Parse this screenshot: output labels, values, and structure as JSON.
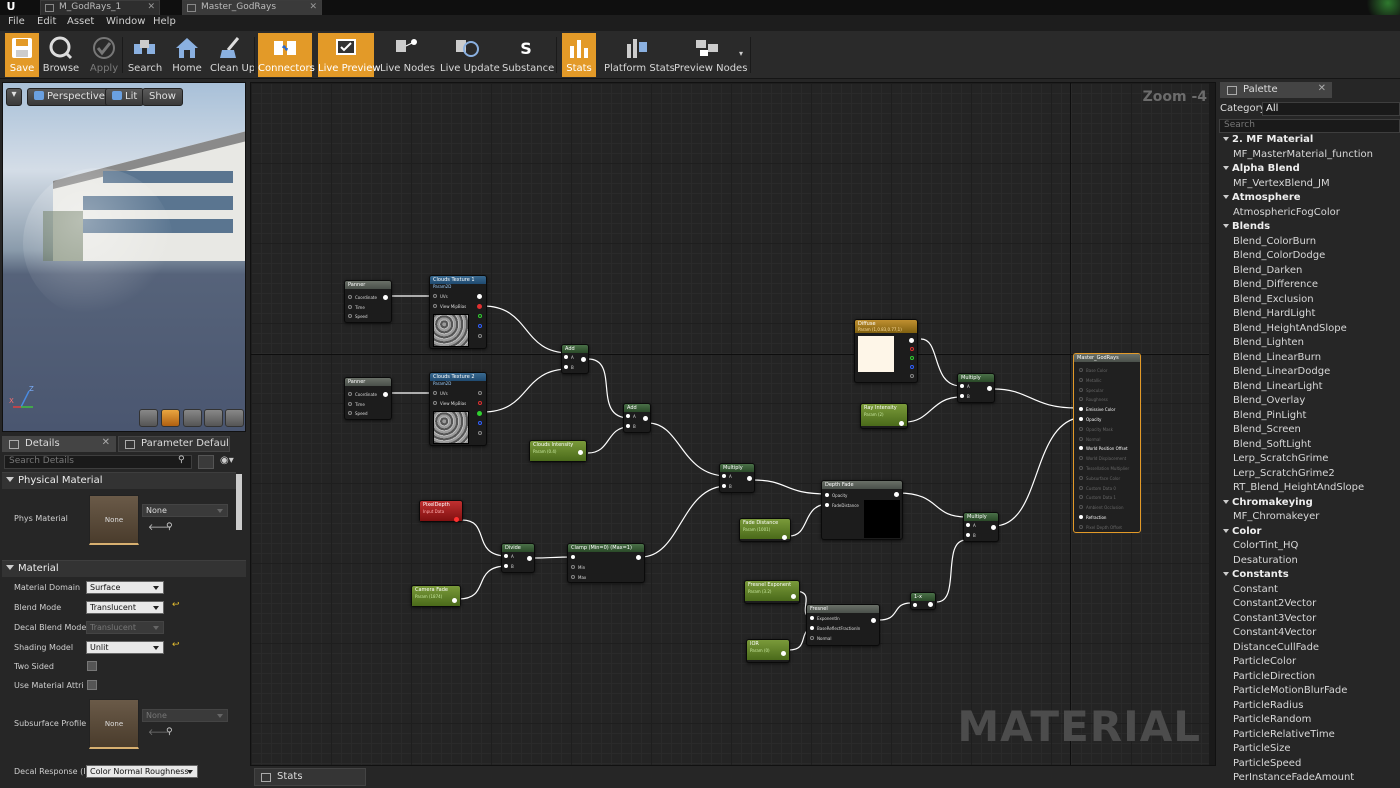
{
  "tabs": [
    {
      "label": "M_GodRays_1"
    },
    {
      "label": "Master_GodRays"
    }
  ],
  "menu": [
    "File",
    "Edit",
    "Asset",
    "Window",
    "Help"
  ],
  "toolbar": [
    {
      "label": "Save",
      "icon": "save-icon",
      "state": "active"
    },
    {
      "label": "Browse",
      "icon": "browse-icon"
    },
    {
      "label": "Apply",
      "icon": "apply-icon",
      "state": "disabled"
    },
    {
      "label": "Search",
      "icon": "search-icon"
    },
    {
      "label": "Home",
      "icon": "home-icon"
    },
    {
      "label": "Clean Up",
      "icon": "clean-up-icon"
    },
    {
      "label": "Connectors",
      "icon": "connectors-icon",
      "state": "active"
    },
    {
      "label": "Live Preview",
      "icon": "live-preview-icon",
      "state": "active"
    },
    {
      "label": "Live Nodes",
      "icon": "live-nodes-icon"
    },
    {
      "label": "Live Update",
      "icon": "live-update-icon"
    },
    {
      "label": "Substance",
      "icon": "substance-icon"
    },
    {
      "label": "Stats",
      "icon": "stats-icon",
      "state": "active"
    },
    {
      "label": "Platform Stats",
      "icon": "platform-stats-icon"
    },
    {
      "label": "Preview Nodes",
      "icon": "preview-nodes-icon"
    }
  ],
  "viewport": {
    "perspective_label": "Perspective",
    "lit_label": "Lit",
    "show_label": "Show",
    "axis_z": "Z",
    "axis_x": "X"
  },
  "details": {
    "tab_label": "Details",
    "param_tab_label": "Parameter Defaults",
    "search_placeholder": "Search Details",
    "physical_material": {
      "header": "Physical Material",
      "phys_material_label": "Phys Material",
      "phys_material_thumb": "None",
      "phys_material_value": "None"
    },
    "material": {
      "header": "Material",
      "material_domain_label": "Material Domain",
      "material_domain_value": "Surface",
      "blend_mode_label": "Blend Mode",
      "blend_mode_value": "Translucent",
      "decal_blend_mode_label": "Decal Blend Mode",
      "decal_blend_mode_value": "Translucent",
      "shading_model_label": "Shading Model",
      "shading_model_value": "Unlit",
      "two_sided_label": "Two Sided",
      "use_material_attri_label": "Use Material Attri",
      "subsurface_profile_label": "Subsurface Profile",
      "subsurface_thumb": "None",
      "subsurface_value": "None",
      "decal_response_label": "Decal Response (I",
      "decal_response_value": "Color Normal Roughness"
    }
  },
  "graph": {
    "zoom": "Zoom -4",
    "watermark": "MATERIAL",
    "nodes": {
      "panner1": {
        "title": "Panner",
        "pins": [
          "Coordinate",
          "Time",
          "Speed"
        ]
      },
      "clouds1": {
        "title": "Clouds Texture 1",
        "sub": "Param2D",
        "pins": [
          "UVs",
          "View MipBias"
        ]
      },
      "panner2": {
        "title": "Panner",
        "pins": [
          "Coordinate",
          "Time",
          "Speed"
        ]
      },
      "clouds2": {
        "title": "Clouds Texture 2",
        "sub": "Param2D",
        "pins": [
          "UVs",
          "View MipBias"
        ]
      },
      "add1": {
        "title": "Add",
        "pins": [
          "A",
          "B"
        ]
      },
      "add2": {
        "title": "Add",
        "pins": [
          "A",
          "B"
        ]
      },
      "clouds_intensity": {
        "title": "Clouds Intensity",
        "sub": "Param (0.4)"
      },
      "multiply1": {
        "title": "Multiply",
        "pins": [
          "A",
          "B"
        ]
      },
      "pixel_depth": {
        "title": "PixelDepth",
        "sub": "Input Data"
      },
      "camera_fade": {
        "title": "Camera Fade",
        "sub": "Param (1874)"
      },
      "divide": {
        "title": "Divide",
        "pins": [
          "A",
          "B"
        ]
      },
      "clamp": {
        "title": "Clamp (Min=0) (Max=1)",
        "pins": [
          "",
          "Min",
          "Max"
        ]
      },
      "depth_fade": {
        "title": "Depth Fade",
        "pins": [
          "Opacity",
          "FadeDistance"
        ]
      },
      "fade_distance": {
        "title": "Fade Distance",
        "sub": "Param (1001)"
      },
      "diffuse": {
        "title": "Diffuse",
        "sub": "Param (1,0.83,0.77,1)"
      },
      "ray_intensity": {
        "title": "Ray Intensity",
        "sub": "Param (2)"
      },
      "multiply2": {
        "title": "Multiply",
        "pins": [
          "A",
          "B"
        ]
      },
      "multiply3": {
        "title": "Multiply",
        "pins": [
          "A",
          "B"
        ]
      },
      "fresnel_exponent": {
        "title": "Fresnel Exponent",
        "sub": "Param (3.2)"
      },
      "ior": {
        "title": "IOR",
        "sub": "Param (0)"
      },
      "fresnel": {
        "title": "Fresnel",
        "pins": [
          "ExponentIn",
          "BaseReflectFractionIn",
          "Normal"
        ]
      },
      "one_minus": {
        "title": "1-x"
      },
      "master": {
        "title": "Master_GodRays",
        "pins": [
          "Base Color",
          "Metallic",
          "Specular",
          "Roughness",
          "Emissive Color",
          "Opacity",
          "Opacity Mask",
          "Normal",
          "World Position Offset",
          "World Displacement",
          "Tessellation Multiplier",
          "Subsurface Color",
          "Custom Data 0",
          "Custom Data 1",
          "Ambient Occlusion",
          "Refraction",
          "Pixel Depth Offset"
        ]
      }
    }
  },
  "stats_tab": "Stats",
  "palette": {
    "tab_label": "Palette",
    "category_label": "Category:",
    "category_value": "All",
    "search_placeholder": "Search",
    "groups": [
      {
        "name": "2. MF Material",
        "items": [
          "MF_MasterMaterial_function"
        ]
      },
      {
        "name": "Alpha Blend",
        "items": [
          "MF_VertexBlend_JM"
        ]
      },
      {
        "name": "Atmosphere",
        "items": [
          "AtmosphericFogColor"
        ]
      },
      {
        "name": "Blends",
        "items": [
          "Blend_ColorBurn",
          "Blend_ColorDodge",
          "Blend_Darken",
          "Blend_Difference",
          "Blend_Exclusion",
          "Blend_HardLight",
          "Blend_HeightAndSlope",
          "Blend_Lighten",
          "Blend_LinearBurn",
          "Blend_LinearDodge",
          "Blend_LinearLight",
          "Blend_Overlay",
          "Blend_PinLight",
          "Blend_Screen",
          "Blend_SoftLight",
          "Lerp_ScratchGrime",
          "Lerp_ScratchGrime2",
          "RT_Blend_HeightAndSlope"
        ]
      },
      {
        "name": "Chromakeying",
        "items": [
          "MF_Chromakeyer"
        ]
      },
      {
        "name": "Color",
        "items": [
          "ColorTint_HQ",
          "Desaturation"
        ]
      },
      {
        "name": "Constants",
        "items": [
          "Constant",
          "Constant2Vector",
          "Constant3Vector",
          "Constant4Vector",
          "DistanceCullFade",
          "ParticleColor",
          "ParticleDirection",
          "ParticleMotionBlurFade",
          "ParticleRadius",
          "ParticleRandom",
          "ParticleRelativeTime",
          "ParticleSize",
          "ParticleSpeed",
          "PerInstanceFadeAmount"
        ]
      }
    ]
  }
}
